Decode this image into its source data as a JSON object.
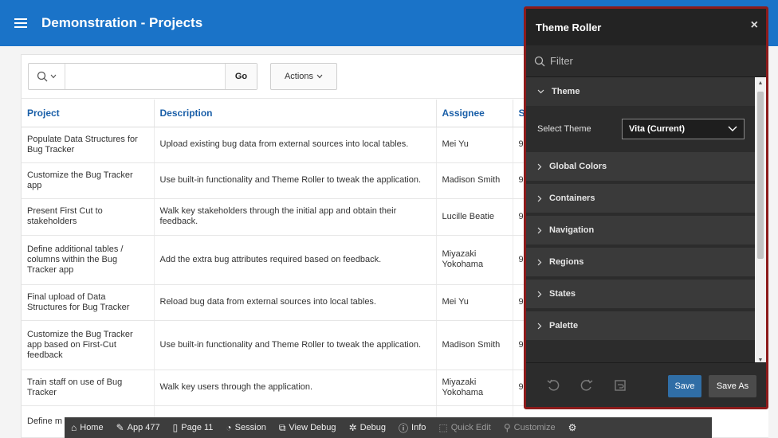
{
  "header": {
    "title": "Demonstration - Projects"
  },
  "report": {
    "search": {
      "value": "",
      "placeholder": ""
    },
    "go_label": "Go",
    "actions_label": "Actions",
    "columns": {
      "project": "Project",
      "description": "Description",
      "assignee": "Assignee",
      "status_partial": "S"
    },
    "rows": [
      {
        "project": "Populate Data Structures for Bug Tracker",
        "description": "Upload existing bug data from external sources into local tables.",
        "assignee": "Mei Yu",
        "status": "9"
      },
      {
        "project": "Customize the Bug Tracker app",
        "description": "Use built-in functionality and Theme Roller to tweak the application.",
        "assignee": "Madison Smith",
        "status": "9"
      },
      {
        "project": "Present First Cut to stakeholders",
        "description": "Walk key stakeholders through the initial app and obtain their feedback.",
        "assignee": "Lucille Beatie",
        "status": "9"
      },
      {
        "project": "Define additional tables / columns within the Bug Tracker app",
        "description": "Add the extra bug attributes required based on feedback.",
        "assignee": "Miyazaki Yokohama",
        "status": "9"
      },
      {
        "project": "Final upload of Data Structures for Bug Tracker",
        "description": "Reload bug data from external sources into local tables.",
        "assignee": "Mei Yu",
        "status": "9"
      },
      {
        "project": "Customize the Bug Tracker app based on First-Cut feedback",
        "description": "Use built-in functionality and Theme Roller to tweak the application.",
        "assignee": "Madison Smith",
        "status": "9"
      },
      {
        "project": "Train staff on use of Bug Tracker",
        "description": "Walk key users through the application.",
        "assignee": "Miyazaki Yokohama",
        "status": "9"
      },
      {
        "project": "Define m for custo",
        "description": "",
        "assignee": "",
        "status": ""
      }
    ]
  },
  "theme_roller": {
    "title": "Theme Roller",
    "close": "×",
    "filter_placeholder": "Filter",
    "theme_section": "Theme",
    "select_theme_label": "Select Theme",
    "select_theme_value": "Vita (Current)",
    "sections": [
      "Global Colors",
      "Containers",
      "Navigation",
      "Regions",
      "States",
      "Palette"
    ],
    "save_label": "Save",
    "save_as_label": "Save As"
  },
  "devbar": {
    "items": [
      {
        "label": "Home",
        "icon": "home-icon",
        "glyph": "⌂"
      },
      {
        "label": "App 477",
        "icon": "edit-icon",
        "glyph": "✎"
      },
      {
        "label": "Page 11",
        "icon": "page-icon",
        "glyph": "▯"
      },
      {
        "label": "Session",
        "icon": "session-icon",
        "glyph": "◔"
      },
      {
        "label": "View Debug",
        "icon": "view-debug-icon",
        "glyph": "⧉"
      },
      {
        "label": "Debug",
        "icon": "debug-icon",
        "glyph": "✲"
      },
      {
        "label": "Info",
        "icon": "info-icon",
        "glyph": "ⓘ"
      },
      {
        "label": "Quick Edit",
        "icon": "quick-edit-icon",
        "glyph": "⬚"
      },
      {
        "label": "Customize",
        "icon": "customize-icon",
        "glyph": "⚲"
      }
    ],
    "settings_icon": "⚙"
  },
  "colors": {
    "header": "#1a73c8",
    "link": "#1a5fa8",
    "roller_border": "#8c1b1b",
    "save": "#306ea6"
  }
}
